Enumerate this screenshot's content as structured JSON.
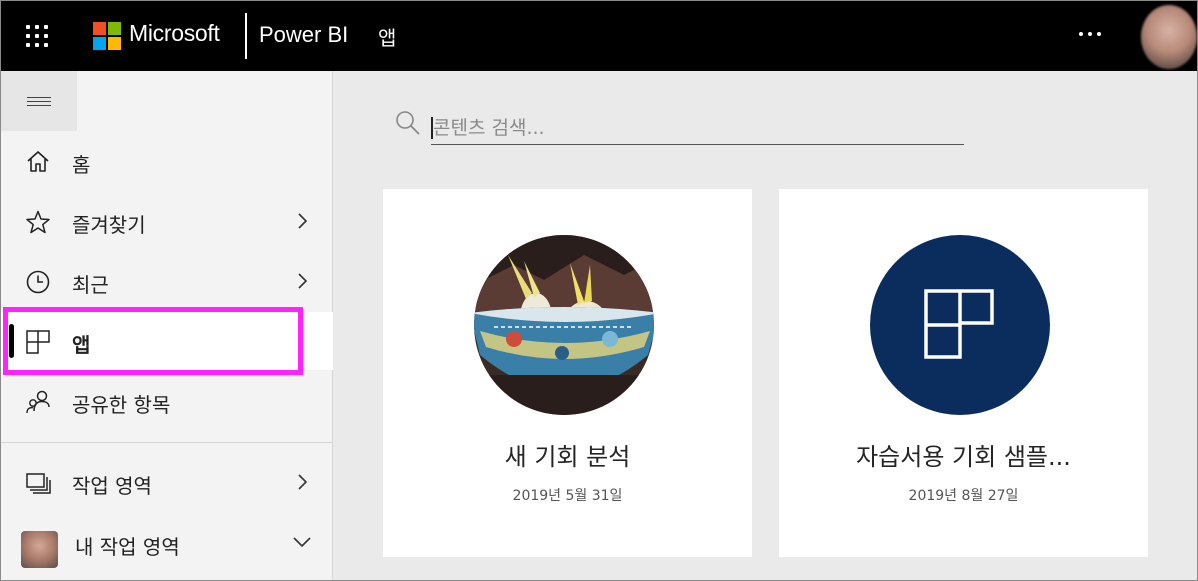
{
  "topbar": {
    "brand": "Microsoft",
    "product": "Power BI",
    "page": "앱",
    "logo_colors": [
      "#f25022",
      "#7fba00",
      "#00a4ef",
      "#ffb900"
    ]
  },
  "sidebar": {
    "items": [
      {
        "label": "홈",
        "icon": "home-icon"
      },
      {
        "label": "즐겨찾기",
        "icon": "star-icon"
      },
      {
        "label": "최근",
        "icon": "clock-icon"
      },
      {
        "label": "앱",
        "icon": "apps-icon"
      },
      {
        "label": "공유한 항목",
        "icon": "shared-people-icon"
      },
      {
        "label": "작업 영역",
        "icon": "workspaces-icon"
      },
      {
        "label": "내 작업 영역",
        "icon": "avatar"
      }
    ],
    "highlight_color": "#ff23ff"
  },
  "search": {
    "placeholder": "콘텐츠 검색..."
  },
  "apps": [
    {
      "title": "새 기회 분석",
      "date": "2019년 5월 31일",
      "thumb": "bird-photo"
    },
    {
      "title": "자습서용 기회 샘플...",
      "date": "2019년 8월 27일",
      "thumb": "apps-icon",
      "color": "#0b2d5e"
    }
  ]
}
